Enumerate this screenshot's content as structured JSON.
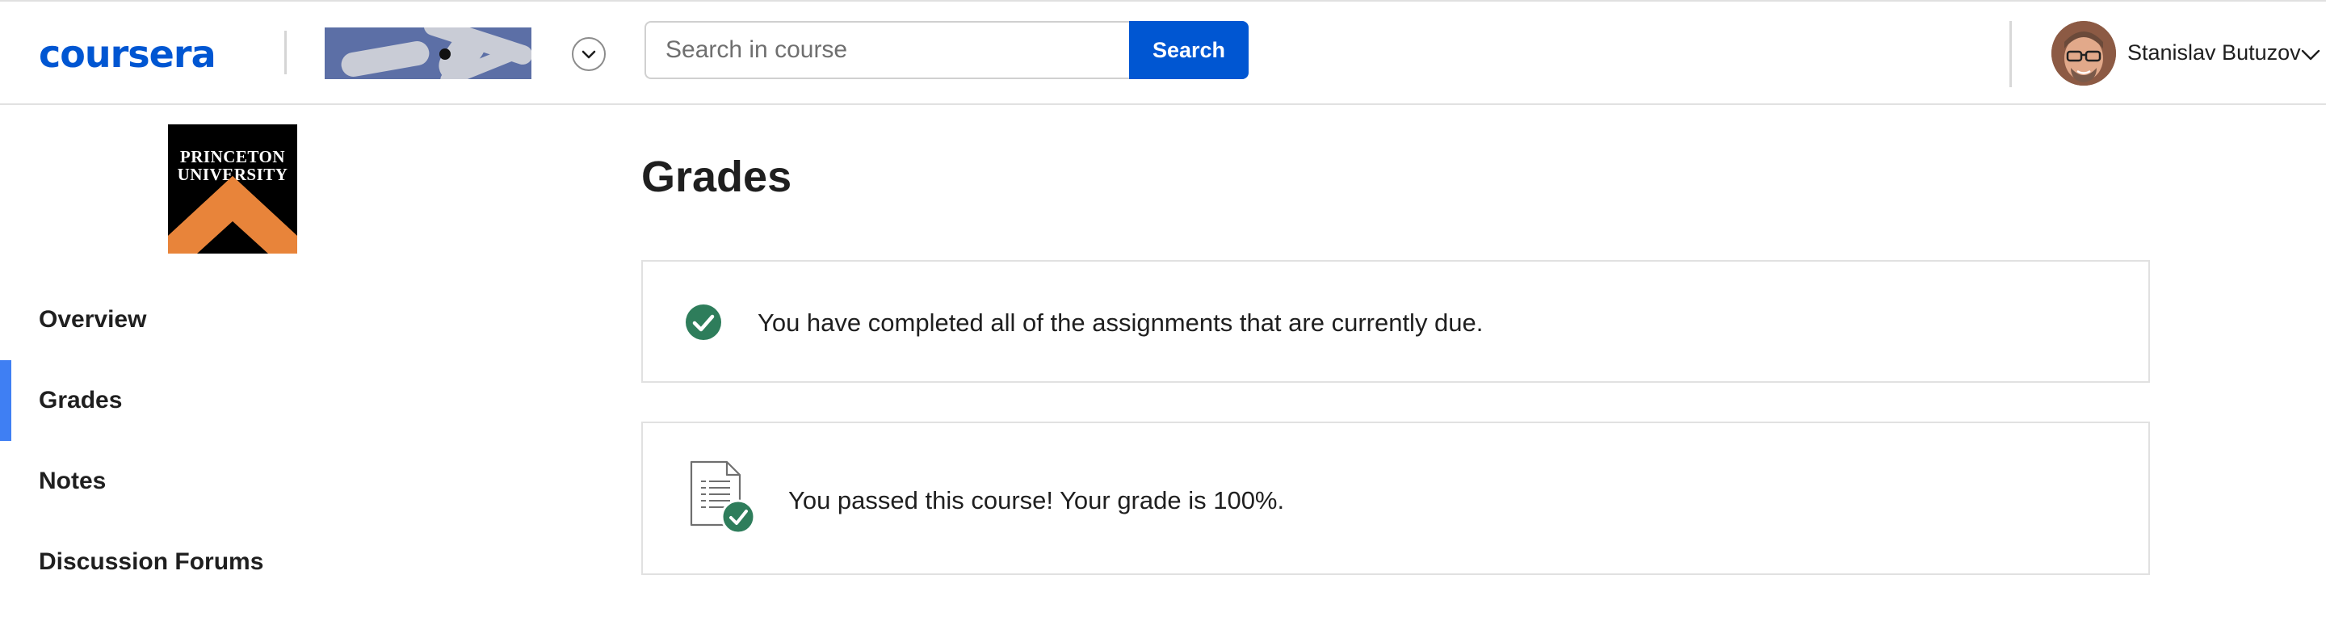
{
  "header": {
    "brand": "coursera",
    "search": {
      "placeholder": "Search in course",
      "value": "",
      "button_label": "Search"
    },
    "user": {
      "name": "Stanislav Butuzov"
    }
  },
  "sidebar": {
    "logo": {
      "line1": "PRINCETON",
      "line2": "UNIVERSITY"
    },
    "items": [
      {
        "label": "Overview",
        "active": false
      },
      {
        "label": "Grades",
        "active": true
      },
      {
        "label": "Notes",
        "active": false
      },
      {
        "label": "Discussion Forums",
        "active": false
      }
    ]
  },
  "main": {
    "title": "Grades",
    "status_card": {
      "icon": "check-circle-icon",
      "text": "You have completed all of the assignments that are currently due."
    },
    "result_card": {
      "icon": "document-check-icon",
      "text": "You passed this course! Your grade is 100%."
    }
  },
  "colors": {
    "brand": "#0056d2",
    "active_indicator": "#3f7ff3",
    "success": "#2e7d5b",
    "princeton_orange": "#e8843a"
  }
}
